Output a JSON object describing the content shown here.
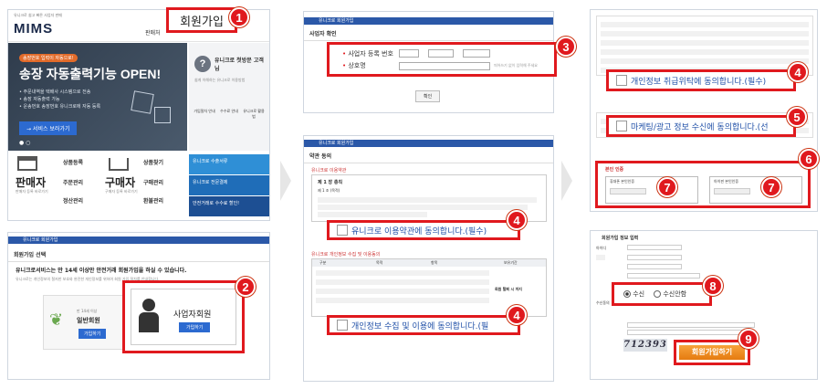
{
  "steps": {
    "s1": "1",
    "s2": "2",
    "s3": "3",
    "s4a": "4",
    "s4b": "4",
    "s4c": "4",
    "s5": "5",
    "s6": "6",
    "s7a": "7",
    "s7b": "7",
    "s8": "8",
    "s9": "9"
  },
  "panel1": {
    "top_links": "유니크로 쉽고 빠른 사업자 판매",
    "logo": "MIMS",
    "signup_label": "회원가입",
    "nav_item": "판매처",
    "banner_small": "송장번호 입력이 자동으로!",
    "banner_title": "송장 자동출력기능 OPEN!",
    "banner_lines": [
      "• 주문내역을 택배사 시스템으로 전송",
      "• 송장 자동출력 가능",
      "• 운송번호 송장번호 유니크로에 자동 등록"
    ],
    "service_button": "→ 서비스 보러가기",
    "side_title": "유니크로 첫방문 고객님",
    "side_sub": "쉽게 이해하는 유니크로 이용방법",
    "side_icons": [
      "가입절차 안내",
      "수수료 안내",
      "유니크로 활용법"
    ],
    "seller_label": "판매자",
    "seller_sub": "판매자 등록 바로가기",
    "seller_items": [
      "상품등록",
      "주문관리",
      "정산관리"
    ],
    "buyer_label": "구매자",
    "buyer_sub": "구매자 등록 바로가기",
    "buyer_items": [
      "상품찾기",
      "구매관리",
      "환불관리"
    ],
    "promo_items": [
      "유니크로 수출서류",
      "유니크로 전문결제",
      "안전거래로 수수료 할인!"
    ]
  },
  "panel2": {
    "bar_title": "유니크로 회원가입",
    "section": "회원가입 선택",
    "headline": "유니크로서비스는 만 14세 이상만 안전거래 회원가입을 하실 수 있습니다.",
    "subline": "유니크로는 개인정보의 철저한 보호와 완전한 개인정보를 위하여 회원 가입 절차를 안내합니다.",
    "general_small": "만 14세 이상",
    "general_title": "일반회원",
    "general_btn": "가입하기",
    "business_title": "사업자회원",
    "business_btn": "가입하기"
  },
  "panel3": {
    "bar_title": "유니크로 회원가입",
    "section": "사업자 확인",
    "bizno_label": "사업자 등록 번호",
    "company_label": "상호명",
    "company_hint": "띄어쓰기 없이 입력해 주세요",
    "confirm_btn": "확인"
  },
  "panel4": {
    "bar_title": "유니크로 회원가입",
    "section": "약관 동의",
    "terms_title": "유니크로 이용약관",
    "chapter": "제 1 장 총칙",
    "article": "제 1 조 (목적)",
    "agree_terms": "유니크로 이용약관에 동의합니다.(필수)",
    "privacy_title": "유니크로 개인정보 수집 및 이용동의",
    "table_headers": [
      "구분",
      "목적",
      "항목",
      "보유기간"
    ],
    "retention": "회원 탈퇴 시 까지",
    "agree_privacy": "개인정보 수집 및 이용에 동의합니다.(필"
  },
  "panel5": {
    "agree_consign": "개인정보 취급위탁에 동의합니다.(필수)",
    "agree_marketing": "마케팅/광고 정보 수신에 동의합니다.(선",
    "safety_title": "본인 인증",
    "cert_left": "휴대폰 본인인증",
    "cert_right": "아이핀 본인인증"
  },
  "panel6": {
    "section": "회원가입 정보 입력",
    "id_label": "아이디",
    "receive_label": "수신동의",
    "sms_option": "수신",
    "reject_option": "수신안함",
    "captcha": "712393",
    "submit_btn": "회원가입하기"
  }
}
